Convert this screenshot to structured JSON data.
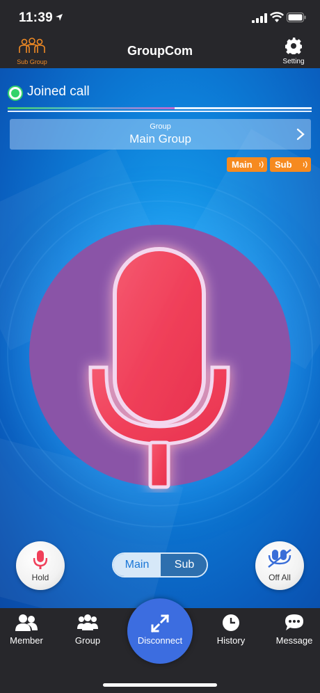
{
  "status_bar": {
    "time": "11:39",
    "icons": [
      "location-arrow-icon",
      "signal-icon",
      "wifi-icon",
      "battery-icon"
    ]
  },
  "nav": {
    "title": "GroupCom",
    "left_button": {
      "label": "Sub Group",
      "icon": "sub-group-people-icon",
      "color": "#f08a24"
    },
    "right_button": {
      "label": "Setting",
      "icon": "gear-icon"
    }
  },
  "call": {
    "status": "Joined call",
    "status_color": "#34d36a",
    "level": 0.55
  },
  "group_selector": {
    "caption": "Group",
    "name": "Main Group",
    "icon": "chevron-right-icon"
  },
  "audio_pills": [
    {
      "label": "Main",
      "icon": "sound-wave-icon",
      "color": "#f68a1f"
    },
    {
      "label": "Sub",
      "icon": "sound-wave-icon",
      "color": "#f68a1f"
    }
  ],
  "mic": {
    "icon": "microphone-icon",
    "circle_color": "#8a54a7",
    "mic_color": "#f0405a"
  },
  "controls": {
    "hold": {
      "label": "Hold",
      "icon": "microphone-icon"
    },
    "off_all": {
      "label": "Off All",
      "icon": "muted-mic-icon"
    },
    "segment": {
      "options": [
        "Main",
        "Sub"
      ],
      "selected": "Main"
    }
  },
  "tabbar": {
    "items": [
      {
        "label": "Member",
        "icon": "member-icon"
      },
      {
        "label": "Group",
        "icon": "group-icon"
      },
      {
        "label": "Disconnect",
        "icon": "expand-arrows-icon"
      },
      {
        "label": "History",
        "icon": "clock-icon"
      },
      {
        "label": "Message",
        "icon": "chat-bubble-icon"
      }
    ]
  },
  "colors": {
    "accent_blue": "#0d7fd9",
    "dark_bar": "#27272b",
    "orange": "#f68a1f",
    "disconnect": "#3c6de0"
  }
}
